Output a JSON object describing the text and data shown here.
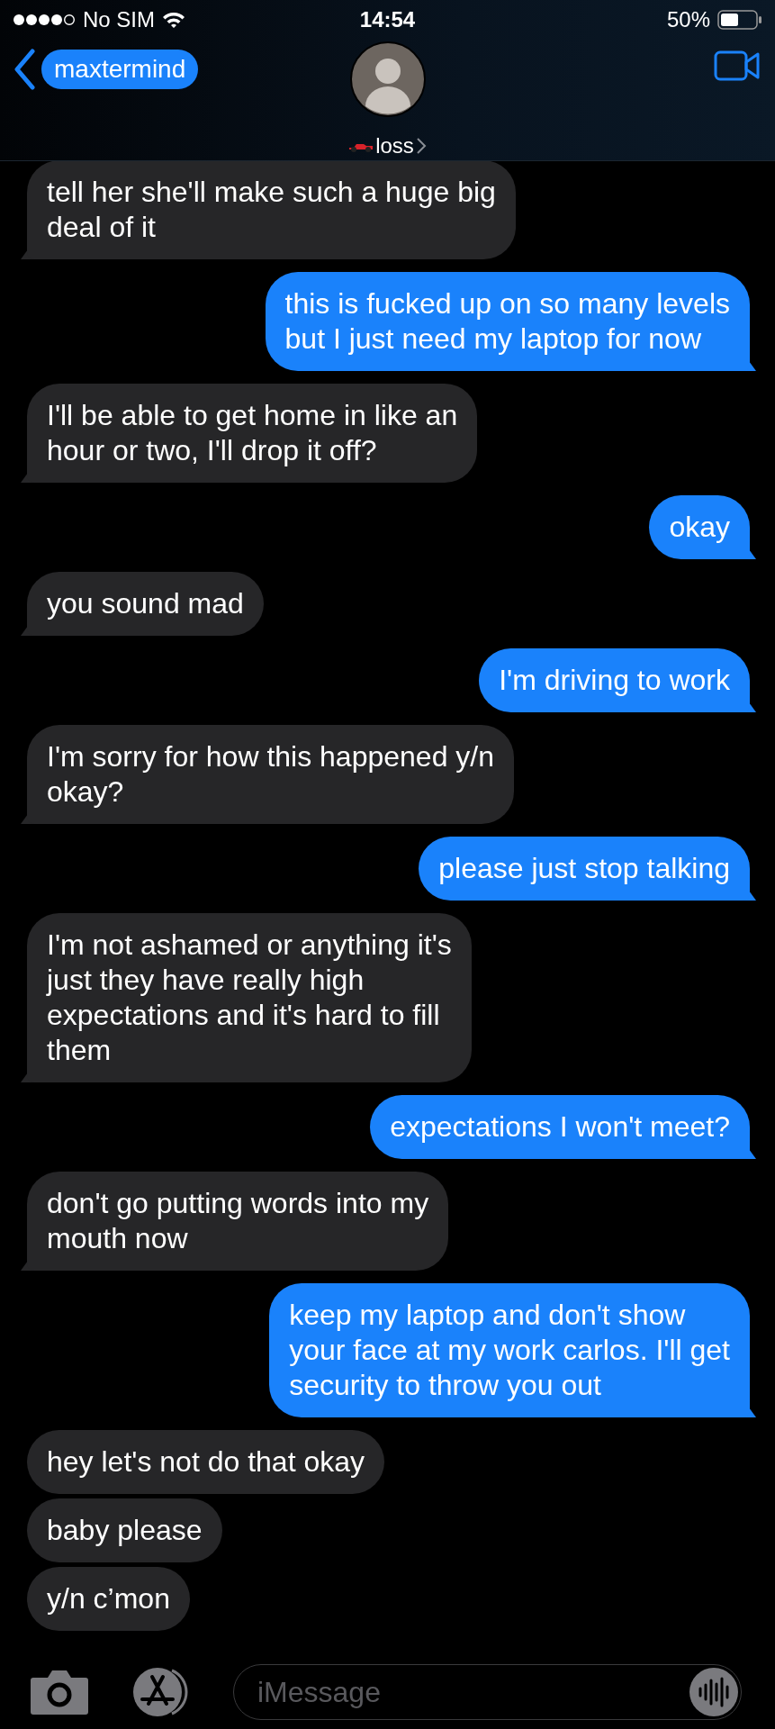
{
  "status_bar": {
    "carrier": "No SIM",
    "time": "14:54",
    "battery": "50%"
  },
  "nav": {
    "back_label": "maxtermind",
    "contact_name": "loss"
  },
  "messages": [
    {
      "kind": "received",
      "text": "tell her she'll make such a huge big\ndeal of it",
      "tail": true
    },
    {
      "kind": "sent",
      "text": "this is fucked up on so many levels\nbut I just need my laptop for now",
      "tail": true
    },
    {
      "kind": "received",
      "text": "I'll be able to get home in like an\nhour or two, I'll drop it off?",
      "tail": true
    },
    {
      "kind": "sent",
      "text": "okay",
      "tail": true
    },
    {
      "kind": "received",
      "text": "you sound mad",
      "tail": true
    },
    {
      "kind": "sent",
      "text": "I'm driving to work",
      "tail": true
    },
    {
      "kind": "received",
      "text": "I'm sorry for how this happened y/n\nokay?",
      "tail": true
    },
    {
      "kind": "sent",
      "text": "please just stop talking",
      "tail": true
    },
    {
      "kind": "received",
      "text": "I'm not ashamed or anything it's\njust they have really high\nexpectations and it's hard to fill\nthem",
      "tail": true
    },
    {
      "kind": "sent",
      "text": "expectations I won't meet?",
      "tail": true
    },
    {
      "kind": "received",
      "text": "don't go putting words into my\nmouth now",
      "tail": true
    },
    {
      "kind": "sent",
      "text": "keep my laptop and don't show\nyour face at my work carlos. I'll get\nsecurity to throw you out",
      "tail": true
    },
    {
      "kind": "received",
      "text": "hey let's not do that okay",
      "tail": false
    },
    {
      "kind": "received",
      "text": "baby please",
      "tail": false
    },
    {
      "kind": "received",
      "text": "y/n c’mon",
      "tail": false
    }
  ],
  "composer": {
    "placeholder": "iMessage"
  }
}
